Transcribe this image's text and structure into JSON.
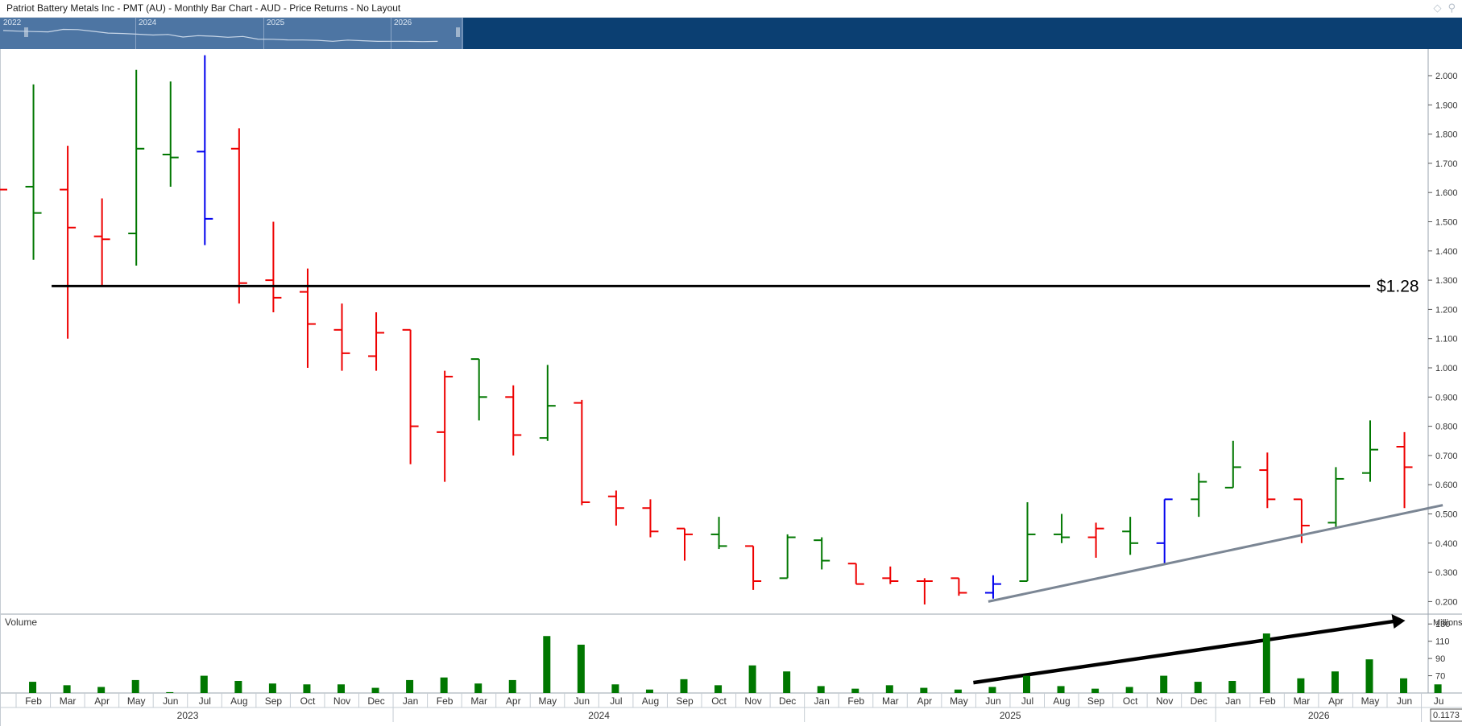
{
  "title": "Patriot Battery Metals Inc - PMT (AU) - Monthly Bar Chart - AUD - Price Returns - No Layout",
  "navigator": {
    "years": [
      "2022",
      "2024",
      "2025",
      "2026"
    ]
  },
  "chart_data": {
    "type": "ohlc",
    "title": "Patriot Battery Metals Inc - PMT (AU) - Monthly Bar Chart - AUD - Price Returns - No Layout",
    "y_range": [
      0.17,
      2.07
    ],
    "y_ticks": [
      "2.000",
      "1.900",
      "1.800",
      "1.700",
      "1.600",
      "1.500",
      "1.400",
      "1.300",
      "1.200",
      "1.100",
      "1.000",
      "0.900",
      "0.800",
      "0.700",
      "0.600",
      "0.500",
      "0.400",
      "0.300",
      "0.200"
    ],
    "colors": {
      "up": "#007700",
      "down": "#ee0000",
      "neutral": "#0000ee"
    },
    "bars": [
      {
        "date": "2023-01",
        "label": "",
        "o": 1.61,
        "h": 1.61,
        "l": 1.61,
        "c": 1.61,
        "color": "down"
      },
      {
        "date": "2023-02",
        "label": "Feb",
        "o": 1.62,
        "h": 1.97,
        "l": 1.37,
        "c": 1.53,
        "color": "up"
      },
      {
        "date": "2023-03",
        "label": "Mar",
        "o": 1.61,
        "h": 1.76,
        "l": 1.1,
        "c": 1.48,
        "color": "down"
      },
      {
        "date": "2023-04",
        "label": "Apr",
        "o": 1.45,
        "h": 1.58,
        "l": 1.28,
        "c": 1.44,
        "color": "down"
      },
      {
        "date": "2023-05",
        "label": "May",
        "o": 1.46,
        "h": 2.02,
        "l": 1.35,
        "c": 1.75,
        "color": "up"
      },
      {
        "date": "2023-06",
        "label": "Jun",
        "o": 1.73,
        "h": 1.98,
        "l": 1.62,
        "c": 1.72,
        "color": "up"
      },
      {
        "date": "2023-07",
        "label": "Jul",
        "o": 1.74,
        "h": 2.07,
        "l": 1.42,
        "c": 1.51,
        "color": "neutral"
      },
      {
        "date": "2023-08",
        "label": "Aug",
        "o": 1.75,
        "h": 1.82,
        "l": 1.22,
        "c": 1.29,
        "color": "down"
      },
      {
        "date": "2023-09",
        "label": "Sep",
        "o": 1.3,
        "h": 1.5,
        "l": 1.19,
        "c": 1.24,
        "color": "down"
      },
      {
        "date": "2023-10",
        "label": "Oct",
        "o": 1.26,
        "h": 1.34,
        "l": 1.0,
        "c": 1.15,
        "color": "down"
      },
      {
        "date": "2023-11",
        "label": "Nov",
        "o": 1.13,
        "h": 1.22,
        "l": 0.99,
        "c": 1.05,
        "color": "down"
      },
      {
        "date": "2023-12",
        "label": "Dec",
        "o": 1.04,
        "h": 1.19,
        "l": 0.99,
        "c": 1.12,
        "color": "down"
      },
      {
        "date": "2024-01",
        "label": "Jan",
        "o": 1.13,
        "h": 1.13,
        "l": 0.67,
        "c": 0.8,
        "color": "down"
      },
      {
        "date": "2024-02",
        "label": "Feb",
        "o": 0.78,
        "h": 0.99,
        "l": 0.61,
        "c": 0.97,
        "color": "down"
      },
      {
        "date": "2024-03",
        "label": "Mar",
        "o": 1.03,
        "h": 1.03,
        "l": 0.82,
        "c": 0.9,
        "color": "up"
      },
      {
        "date": "2024-04",
        "label": "Apr",
        "o": 0.9,
        "h": 0.94,
        "l": 0.7,
        "c": 0.77,
        "color": "down"
      },
      {
        "date": "2024-05",
        "label": "May",
        "o": 0.76,
        "h": 1.01,
        "l": 0.75,
        "c": 0.87,
        "color": "up"
      },
      {
        "date": "2024-06",
        "label": "Jun",
        "o": 0.88,
        "h": 0.89,
        "l": 0.53,
        "c": 0.54,
        "color": "down"
      },
      {
        "date": "2024-07",
        "label": "Jul",
        "o": 0.56,
        "h": 0.58,
        "l": 0.46,
        "c": 0.52,
        "color": "down"
      },
      {
        "date": "2024-08",
        "label": "Aug",
        "o": 0.52,
        "h": 0.55,
        "l": 0.42,
        "c": 0.44,
        "color": "down"
      },
      {
        "date": "2024-09",
        "label": "Sep",
        "o": 0.45,
        "h": 0.45,
        "l": 0.34,
        "c": 0.43,
        "color": "down"
      },
      {
        "date": "2024-10",
        "label": "Oct",
        "o": 0.43,
        "h": 0.49,
        "l": 0.38,
        "c": 0.39,
        "color": "up"
      },
      {
        "date": "2024-11",
        "label": "Nov",
        "o": 0.39,
        "h": 0.39,
        "l": 0.24,
        "c": 0.27,
        "color": "down"
      },
      {
        "date": "2024-12",
        "label": "Dec",
        "o": 0.28,
        "h": 0.43,
        "l": 0.28,
        "c": 0.42,
        "color": "up"
      },
      {
        "date": "2025-01",
        "label": "Jan",
        "o": 0.41,
        "h": 0.42,
        "l": 0.31,
        "c": 0.34,
        "color": "up"
      },
      {
        "date": "2025-02",
        "label": "Feb",
        "o": 0.33,
        "h": 0.33,
        "l": 0.26,
        "c": 0.26,
        "color": "down"
      },
      {
        "date": "2025-03",
        "label": "Mar",
        "o": 0.28,
        "h": 0.32,
        "l": 0.26,
        "c": 0.27,
        "color": "down"
      },
      {
        "date": "2025-04",
        "label": "Apr",
        "o": 0.27,
        "h": 0.28,
        "l": 0.19,
        "c": 0.27,
        "color": "down"
      },
      {
        "date": "2025-05",
        "label": "May",
        "o": 0.28,
        "h": 0.28,
        "l": 0.22,
        "c": 0.23,
        "color": "down"
      },
      {
        "date": "2025-06",
        "label": "Jun",
        "o": 0.23,
        "h": 0.29,
        "l": 0.21,
        "c": 0.26,
        "color": "neutral"
      },
      {
        "date": "2025-07",
        "label": "Jul",
        "o": 0.27,
        "h": 0.54,
        "l": 0.27,
        "c": 0.43,
        "color": "up"
      },
      {
        "date": "2025-08",
        "label": "Aug",
        "o": 0.43,
        "h": 0.5,
        "l": 0.4,
        "c": 0.42,
        "color": "up"
      },
      {
        "date": "2025-09",
        "label": "Sep",
        "o": 0.42,
        "h": 0.47,
        "l": 0.35,
        "c": 0.45,
        "color": "down"
      },
      {
        "date": "2025-10",
        "label": "Oct",
        "o": 0.44,
        "h": 0.49,
        "l": 0.36,
        "c": 0.4,
        "color": "up"
      },
      {
        "date": "2025-11",
        "label": "Nov",
        "o": 0.4,
        "h": 0.55,
        "l": 0.33,
        "c": 0.55,
        "color": "neutral"
      },
      {
        "date": "2025-12",
        "label": "Dec",
        "o": 0.55,
        "h": 0.64,
        "l": 0.49,
        "c": 0.61,
        "color": "up"
      },
      {
        "date": "2026-01",
        "label": "Jan",
        "o": 0.59,
        "h": 0.75,
        "l": 0.59,
        "c": 0.66,
        "color": "up"
      },
      {
        "date": "2026-02",
        "label": "Feb",
        "o": 0.65,
        "h": 0.71,
        "l": 0.52,
        "c": 0.55,
        "color": "down"
      },
      {
        "date": "2026-03",
        "label": "Mar",
        "o": 0.55,
        "h": 0.55,
        "l": 0.4,
        "c": 0.46,
        "color": "down"
      },
      {
        "date": "2026-04",
        "label": "Apr",
        "o": 0.47,
        "h": 0.66,
        "l": 0.45,
        "c": 0.62,
        "color": "up"
      },
      {
        "date": "2026-05",
        "label": "May",
        "o": 0.64,
        "h": 0.82,
        "l": 0.61,
        "c": 0.72,
        "color": "up"
      },
      {
        "date": "2026-06",
        "label": "Jun",
        "o": 0.73,
        "h": 0.78,
        "l": 0.52,
        "c": 0.66,
        "color": "down"
      }
    ],
    "partial_last_month_label": "Ju",
    "years": [
      {
        "label": "2023",
        "start": 0,
        "end": 11
      },
      {
        "label": "2024",
        "start": 12,
        "end": 23
      },
      {
        "label": "2025",
        "start": 24,
        "end": 35
      },
      {
        "label": "2026",
        "start": 36,
        "end": 41
      }
    ],
    "volume": {
      "label": "Volume",
      "unit": "Millions",
      "y_range": [
        50,
        145
      ],
      "y_ticks": [
        "130",
        "110",
        "90",
        "70"
      ],
      "values": [
        50,
        63,
        59,
        57,
        65,
        51,
        70,
        64,
        61,
        60,
        60,
        56,
        65,
        68,
        61,
        65,
        116,
        106,
        60,
        54,
        66,
        59,
        82,
        75,
        58,
        55,
        59,
        56,
        54,
        57,
        70,
        58,
        55,
        57,
        70,
        63,
        64,
        119,
        67,
        75,
        89,
        67,
        60
      ]
    },
    "annotations": [
      {
        "type": "hline",
        "value": 1.28,
        "label": "$1.28",
        "from": "2023-03",
        "to": "2026-06"
      },
      {
        "type": "trendline",
        "from": {
          "date": "2025-06",
          "value": 0.2
        },
        "to": {
          "date": "2026-07",
          "value": 0.53
        }
      },
      {
        "type": "arrow",
        "panel": "volume",
        "from": {
          "date": "2025-05",
          "value": 62
        },
        "to": {
          "date": "2026-06",
          "value": 134
        }
      }
    ],
    "last_value_tag": "0.1173"
  }
}
